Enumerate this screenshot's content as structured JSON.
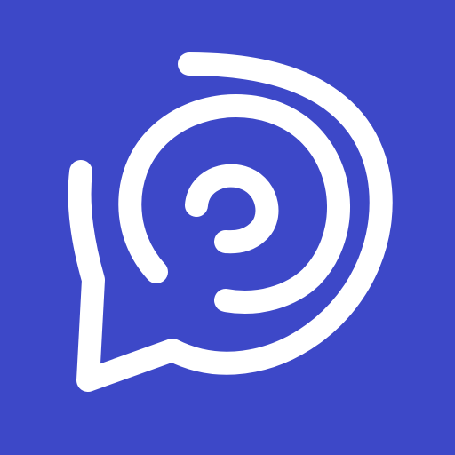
{
  "app_icon": {
    "icon": "spiral-chat-bubble-icon",
    "colors": {
      "background": "#3d48c8",
      "foreground": "#ffffff"
    }
  }
}
